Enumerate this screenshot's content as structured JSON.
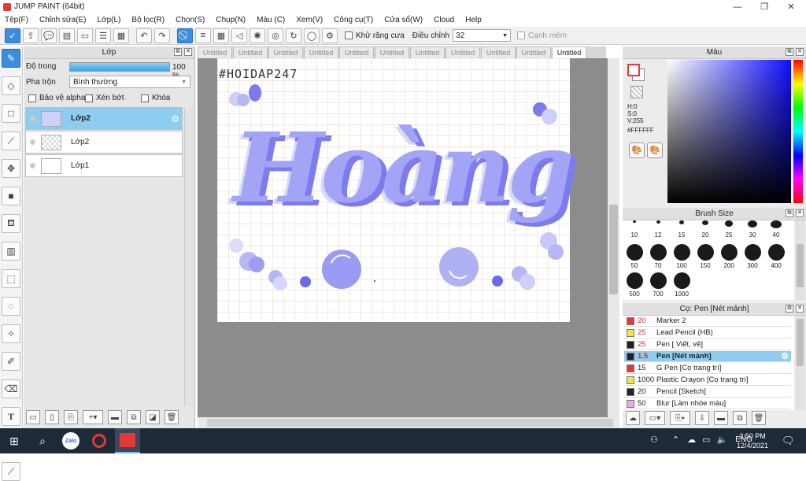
{
  "app": {
    "title": "JUMP PAINT (64bit)"
  },
  "menu": [
    "Tệp(F)",
    "Chỉnh sửa(E)",
    "Lớp(L)",
    "Bộ lọc(R)",
    "Chọn(S)",
    "Chụp(N)",
    "Màu (C)",
    "Xem(V)",
    "Công cụ(T)",
    "Cửa sổ(W)",
    "Cloud",
    "Help"
  ],
  "toolbar": {
    "antialias_label": "Khử răng cưa",
    "adjust_label": "Điều chỉnh",
    "adjust_value": "32",
    "soft_edge_label": "Cạnh mềm"
  },
  "layer_panel": {
    "title": "Lớp",
    "opacity_label": "Độ trong",
    "opacity_value": "100 %",
    "opacity_percent": 100,
    "blend_label": "Pha trộn",
    "blend_value": "Bình thường",
    "protect_alpha_label": "Bảo vệ alpha",
    "clip_label": "Xén bớt",
    "lock_label": "Khóa",
    "layers": [
      {
        "name": "Lớp2",
        "selected": true
      },
      {
        "name": "Lớp2",
        "selected": false
      },
      {
        "name": "Lớp1",
        "selected": false
      }
    ]
  },
  "tabs": [
    "Untitled",
    "Untitled",
    "Untitled",
    "Untitled",
    "Untitled",
    "Untitled",
    "Untitled",
    "Untitled",
    "Untitled",
    "Untitled",
    "Untitled"
  ],
  "canvas": {
    "watermark": "#HOIDAP247",
    "main_text": "Hoàng",
    "accent_color": "#8f8ff2",
    "dark_accent_color": "#6a6ae8"
  },
  "color_panel": {
    "title": "Màu",
    "h": "H:0",
    "s": "S:0",
    "v": "V:255",
    "hex": "#FFFFFF",
    "fg_color": "#ff0000",
    "bg_color": "#ffffff"
  },
  "brush_size_panel": {
    "title": "Brush Size",
    "sizes": [
      "10",
      "12",
      "15",
      "20",
      "25",
      "30",
      "40",
      "50",
      "70",
      "100",
      "150",
      "200",
      "300",
      "400",
      "500",
      "700",
      "1000"
    ]
  },
  "brush_panel": {
    "title": "Cọ: Pen [Nét mảnh]",
    "brushes": [
      {
        "size": "20",
        "name": "Marker 2",
        "color": "#e53935",
        "red": true
      },
      {
        "size": "25",
        "name": "Lead Pencil (HB)",
        "color": "#f2e63a",
        "red": true
      },
      {
        "size": "25",
        "name": "Pen [ Viết, vẽ]",
        "color": "#222222",
        "red": true
      },
      {
        "size": "1.5",
        "name": "Pen [Nét mảnh]",
        "color": "#222222",
        "red": true,
        "selected": true
      },
      {
        "size": "15",
        "name": "G Pen [Cọ trang trí]",
        "color": "#e53935",
        "red": false
      },
      {
        "size": "1000",
        "name": "Plastic Crayon [Cọ trang trí]",
        "color": "#f2e63a",
        "red": false
      },
      {
        "size": "20",
        "name": "Pencil [Sketch]",
        "color": "#222222",
        "red": false
      },
      {
        "size": "50",
        "name": "Blur [Làm nhòe màu]",
        "color": "#f4a6e8",
        "red": false
      }
    ]
  },
  "taskbar": {
    "lang": "ENG",
    "time": "3:50 PM",
    "date": "12/4/2021",
    "zalo_label": "Zalo"
  }
}
